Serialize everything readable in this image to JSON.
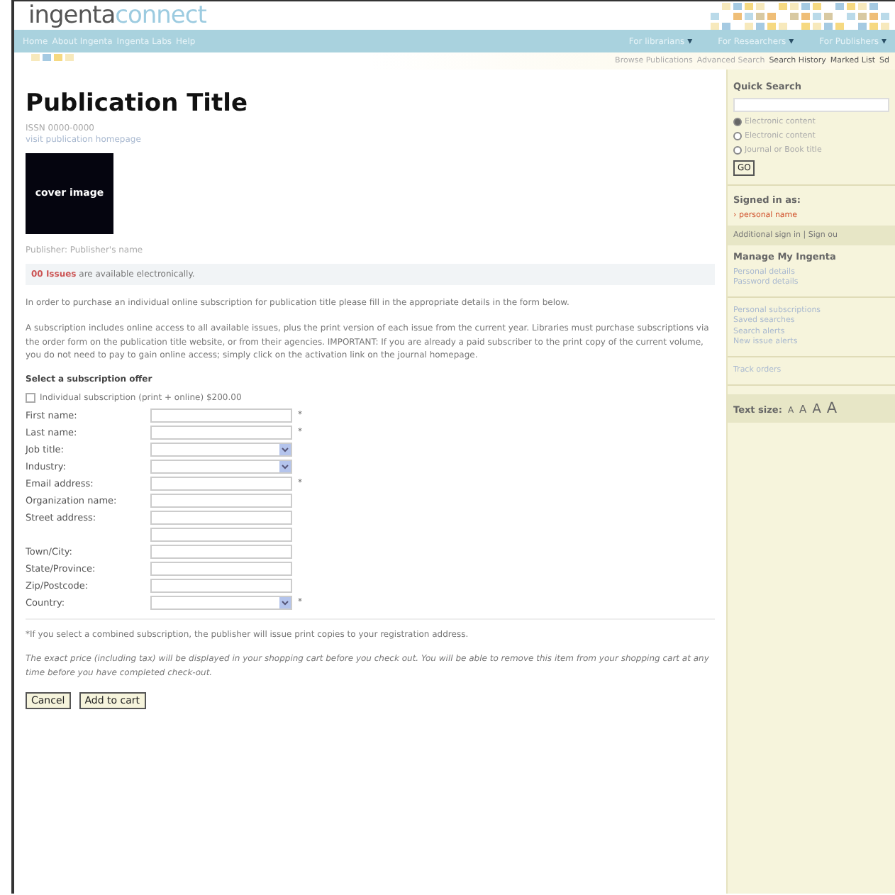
{
  "header": {
    "logo_main": "ingenta",
    "logo_accent": "connect"
  },
  "nav": {
    "links": [
      "Home",
      "About Ingenta",
      "Ingenta Labs",
      "Help"
    ],
    "menus": [
      "For librarians",
      "For Researchers",
      "For Publishers"
    ],
    "caret": "▾"
  },
  "subnav": {
    "links": [
      "Browse Publications",
      "Advanced Search",
      "Search History",
      "Marked List",
      "Sd"
    ]
  },
  "main": {
    "title": "Publication Title",
    "issn": "ISSN 0000-0000",
    "homepage_link": "visit publication homepage",
    "cover": "cover image",
    "publisher": "Publisher: Publisher's name",
    "issues": "**00 Issues** are available electronically.",
    "intro": "In order to purchase an individual online subscription for  publication title  please fill in the appropriate details in the form below.",
    "notice": "A subscription includes online access to all available issues, plus the print version of each issue from the current year. Libraries must purchase subscriptions via the order form on the publication title website, or from their agencies. IMPORTANT: If you are already a paid subscriber to the print copy of the current volume, you do not need to pay to gain online access; simply click on the activation link on the journal homepage.",
    "offer_heading": "Select a subscription offer",
    "offers": [
      {
        "label": "Individual subscription (print + online) $200.00",
        "checked": false
      }
    ],
    "fields": [
      {
        "label": "First name:",
        "kind": "text",
        "marker": "*"
      },
      {
        "label": "Last name:",
        "kind": "text",
        "marker": "*"
      },
      {
        "label": "Job title:",
        "kind": "select"
      },
      {
        "label": "Industry:",
        "kind": "select"
      },
      {
        "label": "Email address:",
        "kind": "text",
        "marker": "*"
      },
      {
        "label": "Organization name:",
        "kind": "text"
      },
      {
        "label": "Street address:",
        "kind": "text"
      },
      {
        "kind": "text"
      },
      {
        "label": "Town/City:",
        "kind": "text"
      },
      {
        "label": "State/Province:",
        "kind": "text"
      },
      {
        "label": "Zip/Postcode:",
        "kind": "text"
      },
      {
        "label": "Country:",
        "kind": "select",
        "marker": "*"
      }
    ],
    "footnote": "*If you select a combined subscription, the publisher will issue print copies to your registration address.",
    "price_note": "The exact price (including tax) will be displayed in your shopping cart before you check out. You will be able to remove this item from your shopping cart at any time before you have completed check-out.",
    "buttons": [
      "Cancel",
      "Add to cart"
    ]
  },
  "sidebar": {
    "search_title": "Quick Search",
    "scopes": [
      {
        "label": "Electronic content",
        "selected": true
      },
      {
        "label": "Electronic content",
        "selected": false
      },
      {
        "label": "Journal or Book title",
        "selected": false
      }
    ],
    "go": "GO",
    "signed_in_label": "Signed in as:",
    "user": "› personal name",
    "account_links": "Additional sign in | Sign ou",
    "manage_title": "Manage My Ingenta",
    "groups": [
      [
        "Personal details",
        "Password details"
      ],
      [
        "Personal subscriptions",
        "Saved searches",
        "Search alerts",
        "New issue alerts"
      ],
      [
        "Track orders"
      ]
    ],
    "text_size_label": "Text size:",
    "text_sizes": [
      "A",
      "A",
      "A",
      "A"
    ]
  }
}
